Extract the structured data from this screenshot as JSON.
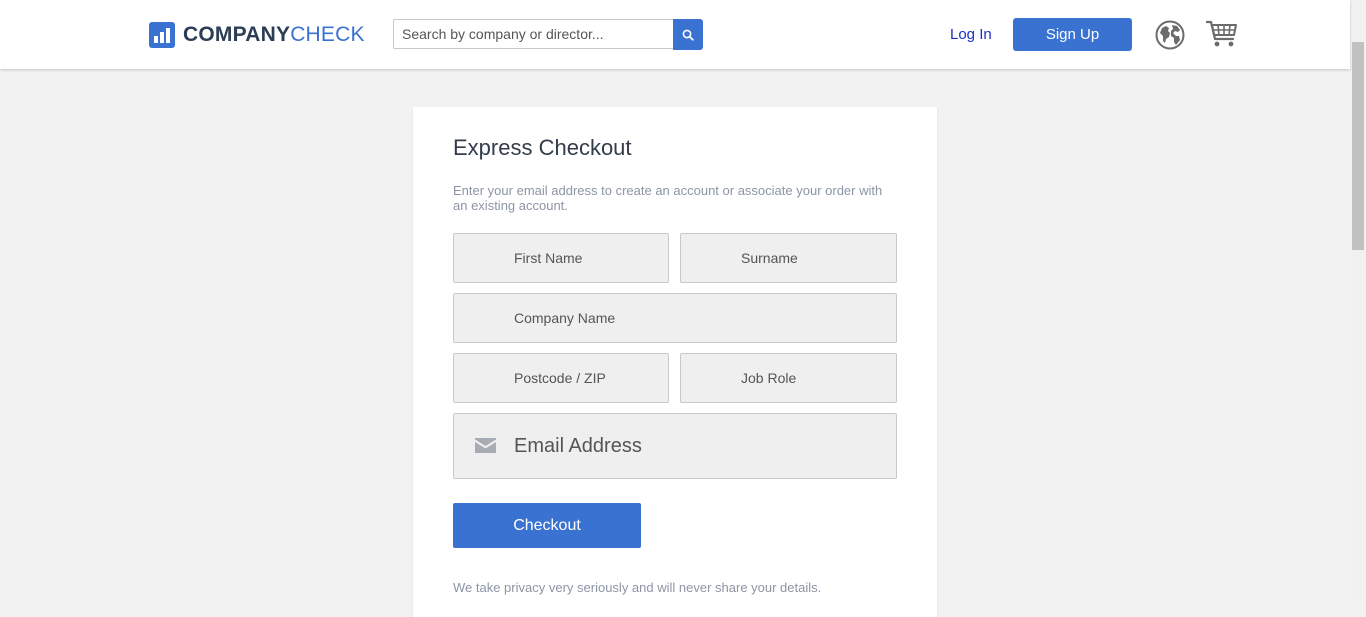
{
  "header": {
    "logo": {
      "part1": "COMPANY",
      "part2": "CHECK"
    },
    "search": {
      "placeholder": "Search by company or director..."
    },
    "login_label": "Log In",
    "signup_label": "Sign Up"
  },
  "checkout": {
    "title": "Express Checkout",
    "intro": "Enter your email address to create an account or associate your order with an existing account.",
    "fields": {
      "first_name": "First Name",
      "surname": "Surname",
      "company_name": "Company Name",
      "postcode": "Postcode / ZIP",
      "job_role": "Job Role",
      "email": "Email Address"
    },
    "button_label": "Checkout",
    "privacy": "We take privacy very seriously and will never share your details."
  },
  "colors": {
    "accent": "#3a72d1",
    "login_link": "#1b2fcb",
    "logo_dark": "#2c3e55"
  },
  "icons": [
    "logo-bars-icon",
    "search-icon",
    "globe-icon",
    "cart-icon",
    "envelope-icon"
  ]
}
